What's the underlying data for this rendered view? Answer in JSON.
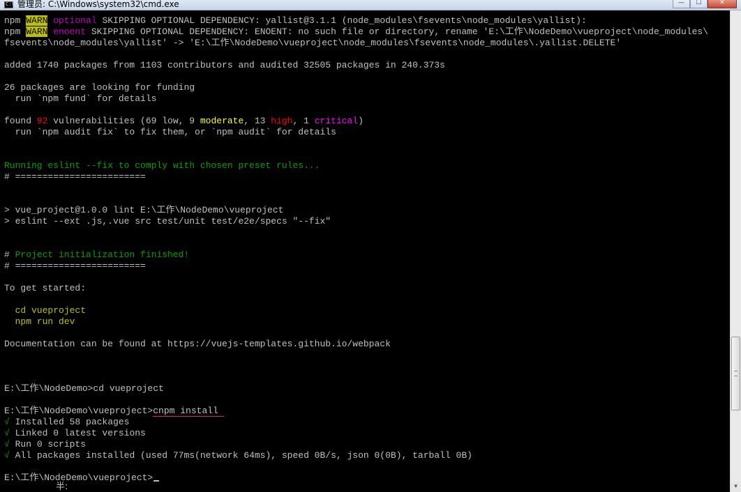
{
  "window": {
    "icon_text": "C:\\",
    "title": "管理员: C:\\Windows\\system32\\cmd.exe",
    "minimize_glyph": "—",
    "maximize_glyph": "☐",
    "close_glyph": "✕"
  },
  "colors": {
    "background": "#000000",
    "text": "#c0c0c0",
    "warn_badge": "#c0c000",
    "magenta": "#c000c0",
    "red": "#ff0000",
    "yellow": "#ffff00",
    "green": "#00a000",
    "olive": "#c0c000"
  },
  "console": {
    "w1_npm": "npm ",
    "w1_badge": "WARN",
    "w1_type": " optional",
    "w1_msg": " SKIPPING OPTIONAL DEPENDENCY: yallist@3.1.1 (node_modules\\fsevents\\node_modules\\yallist):",
    "w2_npm": "npm ",
    "w2_badge": "WARN",
    "w2_type": " enoent",
    "w2_msg": " SKIPPING OPTIONAL DEPENDENCY: ENOENT: no such file or directory, rename 'E:\\工作\\NodeDemo\\vueproject\\node_modules\\",
    "w2_cont": "fsevents\\node_modules\\yallist' -> 'E:\\工作\\NodeDemo\\vueproject\\node_modules\\fsevents\\node_modules\\.yallist.DELETE'",
    "added": "added 1740 packages from 1103 contributors and audited 32505 packages in 240.373s",
    "funding": "26 packages are looking for funding",
    "fund_hint": "  run `npm fund` for details",
    "vuln": {
      "prefix": "found ",
      "total": "92",
      "mid1": " vulnerabilities (69 low, 9 ",
      "moderate": "moderate",
      "mid2": ", 13 ",
      "high": "high",
      "mid3": ", 1 ",
      "critical": "critical",
      "suffix": ")"
    },
    "audit_hint": "  run `npm audit fix` to fix them, or `npm audit` for details",
    "eslint_running": "Running eslint --fix to comply with chosen preset rules...",
    "separator1": "# ========================",
    "lint_script": "> vue_project@1.0.0 lint E:\\工作\\NodeDemo\\vueproject",
    "lint_cmd": "> eslint --ext .js,.vue src test/unit test/e2e/specs \"--fix\"",
    "init_hash": "# ",
    "init_finished": "Project initialization finished!",
    "separator2": "# ========================",
    "get_started": "To get started:",
    "cmd_cd": "  cd vueproject",
    "cmd_run": "  npm run dev",
    "docs": "Documentation can be found at https://vuejs-templates.github.io/webpack",
    "prompt_cd": "E:\\工作\\NodeDemo>cd vueproject",
    "prompt_install_path": "E:\\工作\\NodeDemo\\vueproject>",
    "prompt_install_cmd": "cnpm install ",
    "check": "√",
    "installed": " Installed 58 packages",
    "linked": " Linked 0 latest versions",
    "run_scripts": " Run 0 scripts",
    "all_installed": " All packages installed (used 77ms(network 64ms), speed 0B/s, json 0(0B), tarball 0B)",
    "final_prompt": "E:\\工作\\NodeDemo\\vueproject>",
    "ime_text": "半:"
  },
  "scrollbar": {
    "down_glyph": "▼"
  }
}
